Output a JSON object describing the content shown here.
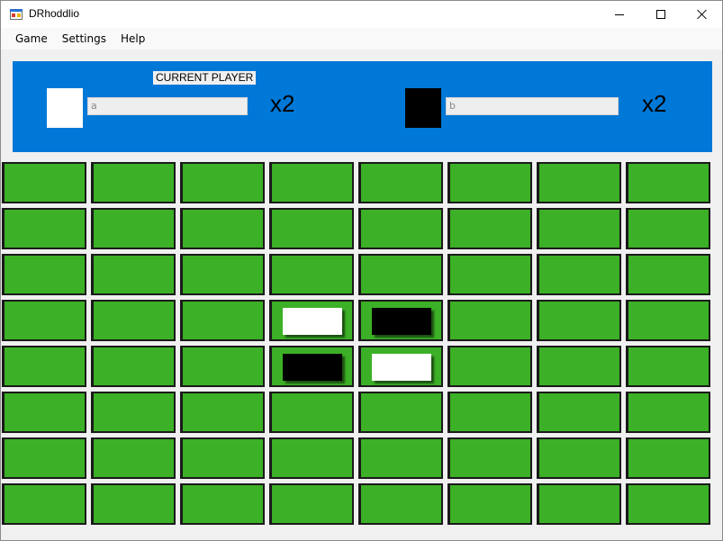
{
  "window": {
    "title": "DRhoddlio"
  },
  "menu": {
    "items": [
      "Game",
      "Settings",
      "Help"
    ]
  },
  "panel": {
    "current_label": "CURRENT PLAYER",
    "player1": {
      "name": "a",
      "score": "x2",
      "color": "#ffffff"
    },
    "player2": {
      "name": "b",
      "score": "x2",
      "color": "#000000"
    },
    "background": "#0078d7"
  },
  "board": {
    "rows": 8,
    "cols": 8,
    "cell_color": "#3cb026",
    "cells": [
      [
        "",
        "",
        "",
        "",
        "",
        "",
        "",
        ""
      ],
      [
        "",
        "",
        "",
        "",
        "",
        "",
        "",
        ""
      ],
      [
        "",
        "",
        "",
        "",
        "",
        "",
        "",
        ""
      ],
      [
        "",
        "",
        "",
        "white",
        "black",
        "",
        "",
        ""
      ],
      [
        "",
        "",
        "",
        "black",
        "white",
        "",
        "",
        ""
      ],
      [
        "",
        "",
        "",
        "",
        "",
        "",
        "",
        ""
      ],
      [
        "",
        "",
        "",
        "",
        "",
        "",
        "",
        ""
      ],
      [
        "",
        "",
        "",
        "",
        "",
        "",
        "",
        ""
      ]
    ]
  }
}
